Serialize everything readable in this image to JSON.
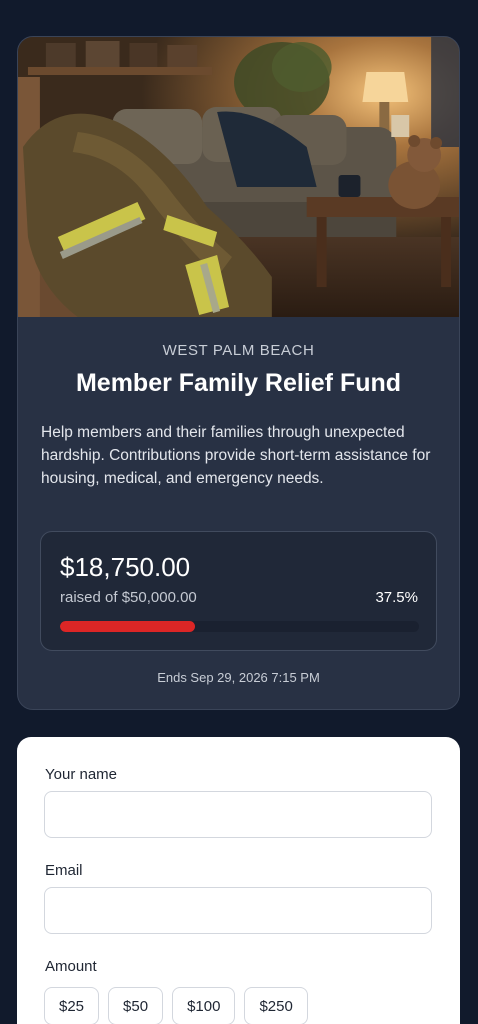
{
  "campaign": {
    "location": "WEST PALM BEACH",
    "title": "Member Family Relief Fund",
    "description": "Help members and their families through unexpected hardship. Contributions provide short-term assistance for housing, medical, and emergency needs.",
    "raised": "$18,750.00",
    "goal_text": "raised of $50,000.00",
    "percent_text": "37.5%",
    "progress_fraction": 0.375,
    "end_date": "Ends Sep 29, 2026 7:15 PM",
    "accent_color": "#dc2626"
  },
  "form": {
    "name_label": "Your name",
    "name_value": "",
    "email_label": "Email",
    "email_value": "",
    "amount_label": "Amount",
    "amount_options": [
      "$25",
      "$50",
      "$100",
      "$250"
    ]
  }
}
